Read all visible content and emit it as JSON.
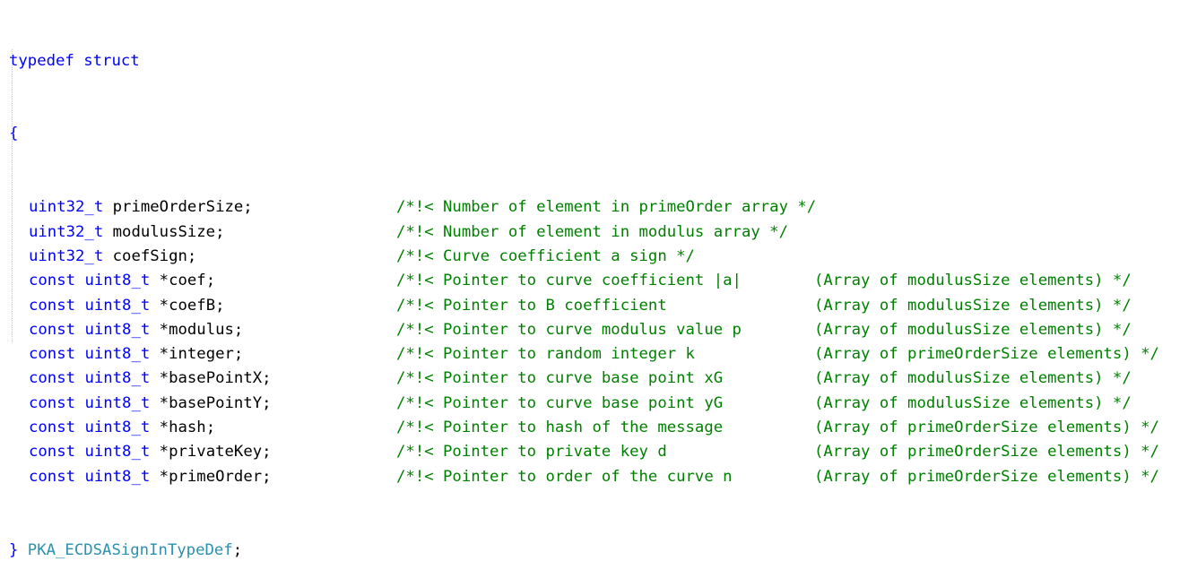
{
  "header": {
    "typedef_kw": "typedef",
    "struct_kw": "struct",
    "open_brace": "{"
  },
  "fields": [
    {
      "type_prefix": "",
      "type": "uint32_t",
      "name": " primeOrderSize;",
      "comment": "/*!< Number of element in primeOrder array */",
      "array_note": ""
    },
    {
      "type_prefix": "",
      "type": "uint32_t",
      "name": " modulusSize;",
      "comment": "/*!< Number of element in modulus array */",
      "array_note": ""
    },
    {
      "type_prefix": "",
      "type": "uint32_t",
      "name": " coefSign;",
      "comment": "/*!< Curve coefficient a sign */",
      "array_note": ""
    },
    {
      "type_prefix": "const ",
      "type": "uint8_t",
      "name": " *coef;",
      "comment": "/*!< Pointer to curve coefficient |a|",
      "array_note": "(Array of modulusSize elements) */"
    },
    {
      "type_prefix": "const ",
      "type": "uint8_t",
      "name": " *coefB;",
      "comment": "/*!< Pointer to B coefficient",
      "array_note": "(Array of modulusSize elements) */"
    },
    {
      "type_prefix": "const ",
      "type": "uint8_t",
      "name": " *modulus;",
      "comment": "/*!< Pointer to curve modulus value p",
      "array_note": "(Array of modulusSize elements) */"
    },
    {
      "type_prefix": "const ",
      "type": "uint8_t",
      "name": " *integer;",
      "comment": "/*!< Pointer to random integer k",
      "array_note": "(Array of primeOrderSize elements) */"
    },
    {
      "type_prefix": "const ",
      "type": "uint8_t",
      "name": " *basePointX;",
      "comment": "/*!< Pointer to curve base point xG",
      "array_note": "(Array of modulusSize elements) */"
    },
    {
      "type_prefix": "const ",
      "type": "uint8_t",
      "name": " *basePointY;",
      "comment": "/*!< Pointer to curve base point yG",
      "array_note": "(Array of modulusSize elements) */"
    },
    {
      "type_prefix": "const ",
      "type": "uint8_t",
      "name": " *hash;",
      "comment": "/*!< Pointer to hash of the message",
      "array_note": "(Array of primeOrderSize elements) */"
    },
    {
      "type_prefix": "const ",
      "type": "uint8_t",
      "name": " *privateKey;",
      "comment": "/*!< Pointer to private key d",
      "array_note": "(Array of primeOrderSize elements) */"
    },
    {
      "type_prefix": "const ",
      "type": "uint8_t",
      "name": " *primeOrder;",
      "comment": "/*!< Pointer to order of the curve n",
      "array_note": "(Array of primeOrderSize elements) */"
    }
  ],
  "footer": {
    "close_brace": "}",
    "type_name": " PKA_ECDSASignInTypeDef",
    "semicolon": ";"
  },
  "colors": {
    "keyword": "#0000ff",
    "type": "#2b91af",
    "comment": "#008000",
    "identifier": "#000000"
  }
}
